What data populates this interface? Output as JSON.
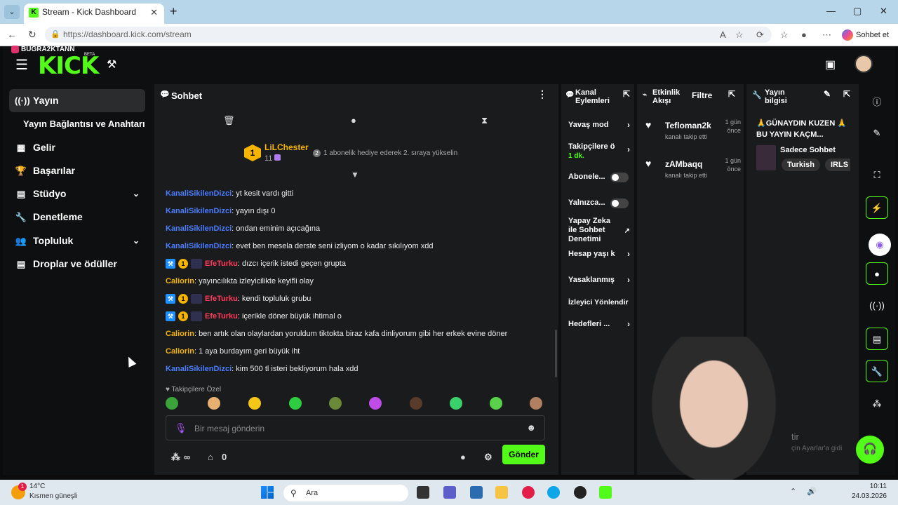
{
  "browser": {
    "tab_title": "Stream - Kick Dashboard",
    "url": "https://dashboard.kick.com/stream",
    "copilot_label": "Sohbet et"
  },
  "header": {
    "logo": "KICK",
    "beta": "BETA",
    "overlay_name": "BUGRA2KTANN"
  },
  "sidebar": {
    "items": [
      {
        "label": "Yayın",
        "icon": "broadcast-icon"
      },
      {
        "label": "Yayın Bağlantısı ve Anahtarı",
        "icon": "none"
      },
      {
        "label": "Gelir",
        "icon": "chart-icon"
      },
      {
        "label": "Başarılar",
        "icon": "trophy-icon"
      },
      {
        "label": "Stüdyo",
        "icon": "studio-icon"
      },
      {
        "label": "Denetleme",
        "icon": "wrench-icon"
      },
      {
        "label": "Topluluk",
        "icon": "people-icon"
      },
      {
        "label": "Droplar ve ödüller",
        "icon": "gift-icon"
      }
    ]
  },
  "chat": {
    "title": "Sohbet",
    "pinned": {
      "badge": "1",
      "user": "LiLChester",
      "count": "11",
      "step": "2",
      "text": "1 abonelik hediye ederek 2. sıraya yükselin"
    },
    "messages": [
      {
        "user": "KanaliSikilenDizci",
        "color": "#4a7dff",
        "text": ": yt kesit vardı gitti",
        "badges": []
      },
      {
        "user": "KanaliSikilenDizci",
        "color": "#4a7dff",
        "text": ": yayın dışı 0",
        "badges": []
      },
      {
        "user": "KanaliSikilenDizci",
        "color": "#4a7dff",
        "text": ": ondan eminim açıcağına",
        "badges": []
      },
      {
        "user": "KanaliSikilenDizci",
        "color": "#4a7dff",
        "text": ": evet ben mesela derste seni izliyom o kadar sıkılıyom xdd",
        "badges": []
      },
      {
        "user": "EfeTurku",
        "color": "#ff3b5c",
        "text": ": dızcı içerik istedi geçen grupta",
        "badges": [
          "tool",
          "gold",
          "sub"
        ]
      },
      {
        "user": "Caliorin",
        "color": "#f5b400",
        "text": ": yayıncılıkta izleyicilikte keyifli olay",
        "badges": []
      },
      {
        "user": "EfeTurku",
        "color": "#ff3b5c",
        "text": ": kendi topluluk grubu",
        "badges": [
          "tool",
          "gold",
          "sub"
        ]
      },
      {
        "user": "EfeTurku",
        "color": "#ff3b5c",
        "text": ": içerikle döner büyük ihtimal o",
        "badges": [
          "tool",
          "gold",
          "sub"
        ]
      },
      {
        "user": "Caliorin",
        "color": "#f5b400",
        "text": ": ben artık olan olaylardan yoruldum tiktokta biraz kafa dinliyorum gibi her erkek evine döner",
        "badges": []
      },
      {
        "user": "Caliorin",
        "color": "#f5b400",
        "text": ": 1 aya burdayım geri büyük iht",
        "badges": []
      },
      {
        "user": "KanaliSikilenDizci",
        "color": "#4a7dff",
        "text": ": kim 500 tl isteri bekliyorum hala xdd",
        "badges": []
      }
    ],
    "emote_header": "Takipçilere Özel",
    "input_placeholder": "Bir mesaj gönderin",
    "points": "∞",
    "gifts": "0",
    "send_label": "Gönder"
  },
  "actions": {
    "title": "Kanal Eylemleri",
    "items": [
      {
        "label": "Yavaş mod",
        "kind": "arrow"
      },
      {
        "label": "Takipçilere ö",
        "sub": "1 dk.",
        "kind": "arrow"
      },
      {
        "label": "Abonele...",
        "kind": "toggle"
      },
      {
        "label": "Yalnızca...",
        "kind": "toggle"
      },
      {
        "label": "Yapay Zeka ile Sohbet Denetimi",
        "kind": "external"
      },
      {
        "label": "Hesap yaşı k",
        "kind": "arrow"
      },
      {
        "label": "Yasaklanmış",
        "kind": "arrow"
      },
      {
        "label": "İzleyici Yönlendir",
        "kind": "none"
      },
      {
        "label": "Hedefleri ...",
        "kind": "arrow"
      }
    ]
  },
  "feed": {
    "title": "Etkinlik Akışı",
    "filter": "Filtre",
    "items": [
      {
        "name": "Tefloman2k",
        "time": "1 gün önce",
        "desc": "kanalı takip etti"
      },
      {
        "name": "zAMbaqq",
        "time": "1 gün önce",
        "desc": "kanalı takip etti"
      }
    ]
  },
  "info": {
    "title": "Yayın bilgisi",
    "stream_title": "🙏GÜNAYDIN KUZEN 🙏BU YAYIN KAÇM...",
    "category": "Sadece Sohbet",
    "tags": [
      "Turkish",
      "IRLS"
    ]
  },
  "overlay_ghost": {
    "line1": "tir",
    "line2": "çin Ayarlar'a gidi"
  },
  "taskbar": {
    "temp": "14°C",
    "weather": "Kısmen güneşli",
    "notif": "1",
    "search": "Ara",
    "time": "10:11",
    "date": "24.03.2026"
  },
  "colors": {
    "accent": "#53fc18",
    "panel": "#1a1b1d",
    "bg": "#0e0f10"
  }
}
